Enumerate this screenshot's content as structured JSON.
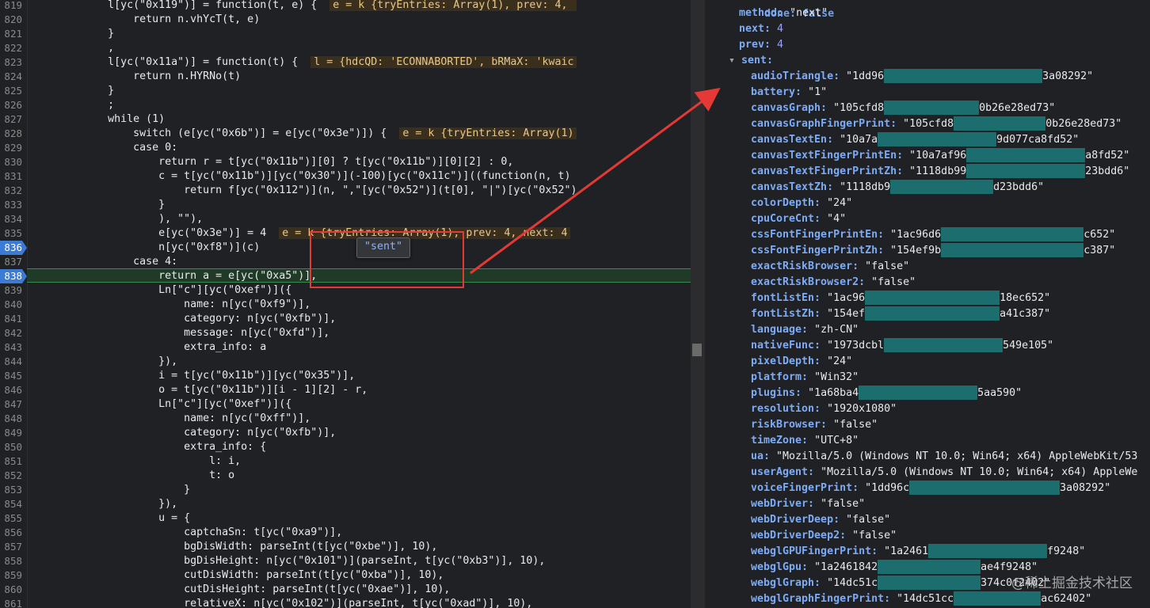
{
  "colors": {
    "accent_arrow": "#e53935",
    "breakpoint": "#3b7bd6",
    "current_line": "#1f3b28"
  },
  "editor": {
    "lines": [
      {
        "n": "819",
        "t": "            l[yc(\"0x119\")] = function(t, e) {  ",
        "inline": "e = k {tryEntries: Array(1), prev: 4, "
      },
      {
        "n": "820",
        "t": "                return n.vhYcT(t, e)"
      },
      {
        "n": "821",
        "t": "            }"
      },
      {
        "n": "822",
        "t": "            ,"
      },
      {
        "n": "823",
        "t": "            l[yc(\"0x11a\")] = function(t) {  ",
        "inline": "l = {hdcQD: 'ECONNABORTED', bRMaX: 'kwaic"
      },
      {
        "n": "824",
        "t": "                return n.HYRNo(t)"
      },
      {
        "n": "825",
        "t": "            }"
      },
      {
        "n": "826",
        "t": "            ;"
      },
      {
        "n": "827",
        "t": "            while (1)"
      },
      {
        "n": "828",
        "t": "                switch (e[yc(\"0x6b\")] = e[yc(\"0x3e\")]) {  ",
        "inline": "e = k {tryEntries: Array(1)"
      },
      {
        "n": "829",
        "t": "                case 0:"
      },
      {
        "n": "830",
        "t": "                    return r = t[yc(\"0x11b\")][0] ? t[yc(\"0x11b\")][0][2] : 0,"
      },
      {
        "n": "831",
        "t": "                    c = t[yc(\"0x11b\")][yc(\"0x30\")](-100)[yc(\"0x11c\")]((function(n, t)"
      },
      {
        "n": "832",
        "t": "                        return f[yc(\"0x112\")](n, \",\"[yc(\"0x52\")](t[0], \"|\")[yc(\"0x52\")"
      },
      {
        "n": "833",
        "t": "                    }"
      },
      {
        "n": "834",
        "t": "                    ), \"\"),"
      },
      {
        "n": "835",
        "t": "                    e[yc(\"0x3e\")] = 4  ",
        "inline": "e = k {tryEntries: Array(1), prev: 4, next: 4"
      },
      {
        "n": "836",
        "t": "                    n[yc(\"0xf8\")](c)",
        "bp": true
      },
      {
        "n": "837",
        "t": "                case 4:"
      },
      {
        "n": "838",
        "t": "                    return a = e[yc(\"0xa5\")],",
        "bp": true
      },
      {
        "n": "839",
        "t": "                    Ln[\"c\"][yc(\"0xef\")]({"
      },
      {
        "n": "840",
        "t": "                        name: n[yc(\"0xf9\")],"
      },
      {
        "n": "841",
        "t": "                        category: n[yc(\"0xfb\")],"
      },
      {
        "n": "842",
        "t": "                        message: n[yc(\"0xfd\")],"
      },
      {
        "n": "843",
        "t": "                        extra_info: a"
      },
      {
        "n": "844",
        "t": "                    }),"
      },
      {
        "n": "845",
        "t": "                    i = t[yc(\"0x11b\")][yc(\"0x35\")],"
      },
      {
        "n": "846",
        "t": "                    o = t[yc(\"0x11b\")][i - 1][2] - r,"
      },
      {
        "n": "847",
        "t": "                    Ln[\"c\"][yc(\"0xef\")]({"
      },
      {
        "n": "848",
        "t": "                        name: n[yc(\"0xff\")],"
      },
      {
        "n": "849",
        "t": "                        category: n[yc(\"0xfb\")],"
      },
      {
        "n": "850",
        "t": "                        extra_info: {"
      },
      {
        "n": "851",
        "t": "                            l: i,"
      },
      {
        "n": "852",
        "t": "                            t: o"
      },
      {
        "n": "853",
        "t": "                        }"
      },
      {
        "n": "854",
        "t": "                    }),"
      },
      {
        "n": "855",
        "t": "                    u = {"
      },
      {
        "n": "856",
        "t": "                        captchaSn: t[yc(\"0xa9\")],"
      },
      {
        "n": "857",
        "t": "                        bgDisWidth: parseInt(t[yc(\"0xbe\")], 10),"
      },
      {
        "n": "858",
        "t": "                        bgDisHeight: n[yc(\"0x101\")](parseInt, t[yc(\"0xb3\")], 10),"
      },
      {
        "n": "859",
        "t": "                        cutDisWidth: parseInt(t[yc(\"0xba\")], 10),"
      },
      {
        "n": "860",
        "t": "                        cutDisHeight: parseInt(t[yc(\"0xae\")], 10),"
      },
      {
        "n": "861",
        "t": "                        relativeX: n[yc(\"0x102\")](parseInt, t[yc(\"0xad\")], 10),"
      }
    ],
    "tooltip": "\"sent\""
  },
  "scope": {
    "top_partial": "done: false",
    "rows": [
      {
        "k": "method",
        "v": "\"next\"",
        "type": "str"
      },
      {
        "k": "next",
        "v": "4",
        "type": "num"
      },
      {
        "k": "prev",
        "v": "4",
        "type": "num"
      },
      {
        "k": "sent",
        "v": "",
        "type": "head"
      },
      {
        "k": "audioTriangle",
        "pre": "\"1dd96",
        "post": "3a08292\"",
        "gap": 200
      },
      {
        "k": "battery",
        "v": "\"1\"",
        "type": "str"
      },
      {
        "k": "canvasGraph",
        "pre": "\"105cfd8",
        "post": "0b26e28ed73\"",
        "gap": 120
      },
      {
        "k": "canvasGraphFingerPrint",
        "pre": "\"105cfd8",
        "post": "0b26e28ed73\"",
        "gap": 116
      },
      {
        "k": "canvasTextEn",
        "pre": "\"10a7a",
        "post": "9d077ca8fd52\"",
        "gap": 150
      },
      {
        "k": "canvasTextFingerPrintEn",
        "pre": "\"10a7af96",
        "post": "a8fd52\"",
        "gap": 150
      },
      {
        "k": "canvasTextFingerPrintZh",
        "pre": "\"1118db99",
        "post": "23bdd6\"",
        "gap": 150
      },
      {
        "k": "canvasTextZh",
        "pre": "\"1118db9",
        "post": "d23bdd6\"",
        "gap": 130
      },
      {
        "k": "colorDepth",
        "v": "\"24\"",
        "type": "str"
      },
      {
        "k": "cpuCoreCnt",
        "v": "\"4\"",
        "type": "str"
      },
      {
        "k": "cssFontFingerPrintEn",
        "pre": "\"1ac96d6",
        "post": "c652\"",
        "gap": 180
      },
      {
        "k": "cssFontFingerPrintZh",
        "pre": "\"154ef9b",
        "post": "c387\"",
        "gap": 180
      },
      {
        "k": "exactRiskBrowser",
        "v": "\"false\"",
        "type": "str"
      },
      {
        "k": "exactRiskBrowser2",
        "v": "\"false\"",
        "type": "str"
      },
      {
        "k": "fontListEn",
        "pre": "\"1ac96",
        "post": "18ec652\"",
        "gap": 170
      },
      {
        "k": "fontListZh",
        "pre": "\"154ef",
        "post": "a41c387\"",
        "gap": 170
      },
      {
        "k": "language",
        "v": "\"zh-CN\"",
        "type": "str"
      },
      {
        "k": "nativeFunc",
        "pre": "\"1973dcbl",
        "post": "549e105\"",
        "gap": 150
      },
      {
        "k": "pixelDepth",
        "v": "\"24\"",
        "type": "str"
      },
      {
        "k": "platform",
        "v": "\"Win32\"",
        "type": "str"
      },
      {
        "k": "plugins",
        "pre": "\"1a68ba4",
        "post": "5aa590\"",
        "gap": 150
      },
      {
        "k": "resolution",
        "v": "\"1920x1080\"",
        "type": "str"
      },
      {
        "k": "riskBrowser",
        "v": "\"false\"",
        "type": "str"
      },
      {
        "k": "timeZone",
        "v": "\"UTC+8\"",
        "type": "str"
      },
      {
        "k": "ua",
        "v": "\"Mozilla/5.0 (Windows NT 10.0; Win64; x64) AppleWebKit/53",
        "type": "plain"
      },
      {
        "k": "userAgent",
        "v": "\"Mozilla/5.0 (Windows NT 10.0; Win64; x64) AppleWe",
        "type": "plain"
      },
      {
        "k": "voiceFingerPrint",
        "pre": "\"1dd96c",
        "post": "3a08292\"",
        "gap": 190
      },
      {
        "k": "webDriver",
        "v": "\"false\"",
        "type": "str"
      },
      {
        "k": "webDriverDeep",
        "v": "\"false\"",
        "type": "str"
      },
      {
        "k": "webDriverDeep2",
        "v": "\"false\"",
        "type": "str"
      },
      {
        "k": "webglGPUFingerPrint",
        "pre": "\"1a2461",
        "post": "f9248\"",
        "gap": 150
      },
      {
        "k": "webglGpu",
        "pre": "\"1a2461842",
        "post": "ae4f9248\"",
        "gap": 130
      },
      {
        "k": "webglGraph",
        "pre": "\"14dc51c",
        "post": "374c0f2402\"",
        "gap": 130
      },
      {
        "k": "webglGraphFingerPrint",
        "pre": "\"14dc51cc",
        "post": "ac62402\"",
        "gap": 110
      }
    ]
  },
  "watermark": "@稀土掘金技术社区"
}
